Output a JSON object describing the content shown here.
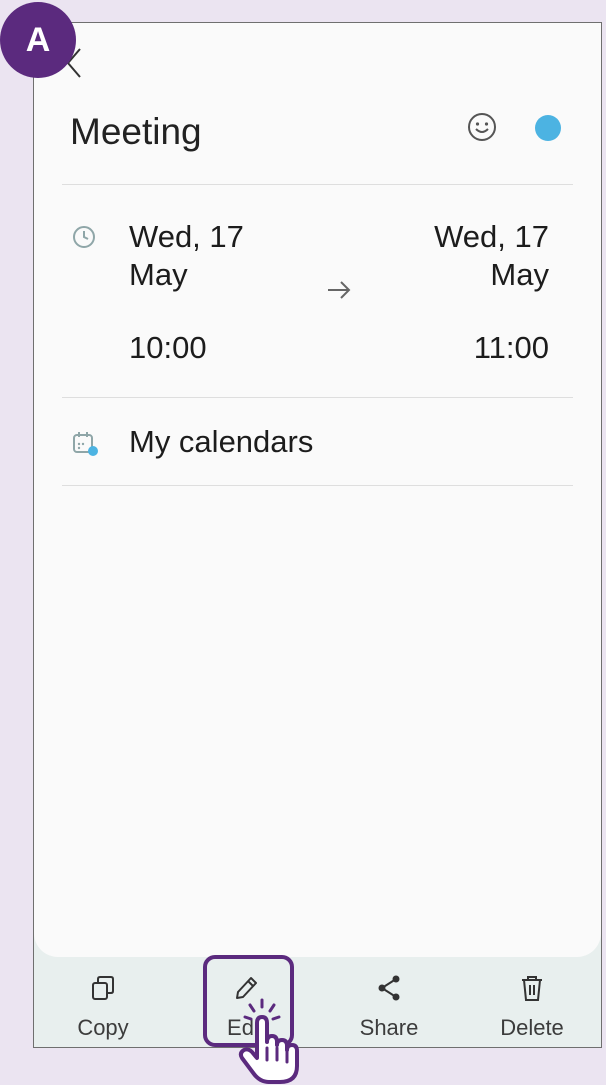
{
  "badge_letter": "A",
  "event": {
    "title": "Meeting",
    "color": "#4cb3e2",
    "start_date": "Wed, 17 May",
    "end_date": "Wed, 17 May",
    "start_time": "10:00",
    "end_time": "11:00",
    "calendar": "My calendars"
  },
  "toolbar": {
    "copy_label": "Copy",
    "edit_label": "Edit",
    "share_label": "Share",
    "delete_label": "Delete"
  },
  "icons": [
    "back-arrow-icon",
    "emoji-icon",
    "clock-icon",
    "right-arrow-icon",
    "calendar-icon",
    "copy-icon",
    "pencil-icon",
    "share-icon",
    "trash-icon",
    "tap-hand-icon"
  ],
  "colors": {
    "accent": "#5b2a7e",
    "event_dot": "#4cb3e2",
    "background": "#ebe4f1"
  }
}
